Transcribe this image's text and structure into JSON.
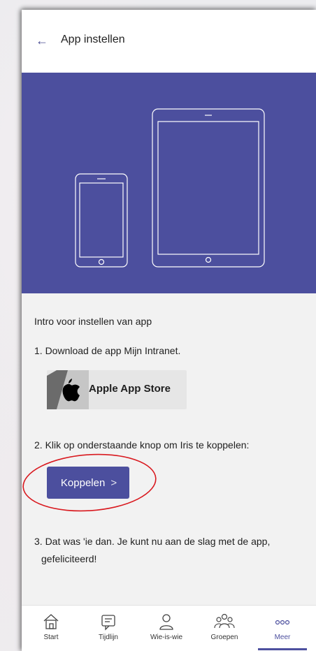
{
  "header": {
    "back_icon": "arrow-left-icon",
    "title": "App instellen"
  },
  "intro": "Intro voor instellen van app",
  "step1": "1. Download de app Mijn Intranet.",
  "store_button": {
    "label": "Apple App Store",
    "icon": "apple-icon"
  },
  "step2": "2. Klik op onderstaande knop om Iris te koppelen:",
  "koppelen_button": {
    "label": "Koppelen",
    "chevron": ">"
  },
  "step3_line1": "3. Dat was 'ie dan. Je kunt nu aan de slag met de app,",
  "step3_line2": "gefeliciteerd!",
  "tabs": [
    {
      "label": "Start",
      "icon": "home-icon"
    },
    {
      "label": "Tijdlijn",
      "icon": "timeline-icon"
    },
    {
      "label": "Wie-is-wie",
      "icon": "person-icon"
    },
    {
      "label": "Groepen",
      "icon": "groups-icon"
    },
    {
      "label": "Meer",
      "icon": "more-icon"
    }
  ],
  "active_tab": "Meer",
  "colors": {
    "accent": "#4c4f9e",
    "annotation": "#d9191f"
  }
}
